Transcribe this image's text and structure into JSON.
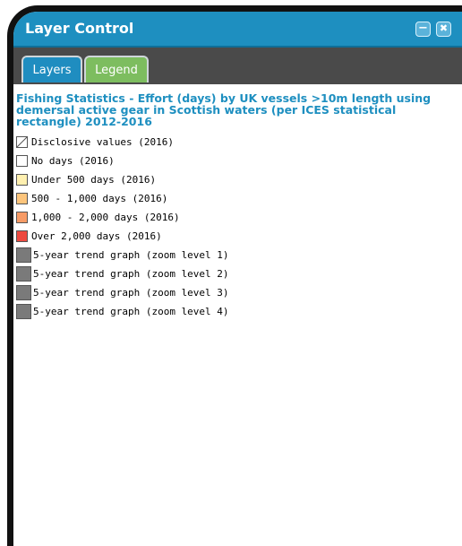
{
  "window": {
    "title": "Layer Control",
    "minimize_glyph": "−",
    "close_glyph": "✖"
  },
  "tabs": [
    {
      "label": "Layers",
      "color": "#1f8dc0"
    },
    {
      "label": "Legend",
      "color": "#7dbd5f",
      "active": true
    }
  ],
  "legend": {
    "title": "Fishing Statistics - Effort (days) by UK vessels >10m length using demersal active gear in Scottish waters (per ICES statistical rectangle) 2012-2016",
    "items": [
      {
        "label": "Disclosive values (2016)",
        "color": "#ffffff",
        "pattern": "diagonal"
      },
      {
        "label": "No days (2016)",
        "color": "#ffffff"
      },
      {
        "label": "Under 500 days (2016)",
        "color": "#fff0b0"
      },
      {
        "label": "500 - 1,000 days (2016)",
        "color": "#fdc57c"
      },
      {
        "label": "1,000 - 2,000 days (2016)",
        "color": "#f79b66"
      },
      {
        "label": "Over 2,000 days (2016)",
        "color": "#ee4a40"
      },
      {
        "label": "5-year trend graph (zoom level 1)",
        "color": "#7a7a7a"
      },
      {
        "label": "5-year trend graph (zoom level 2)",
        "color": "#7a7a7a"
      },
      {
        "label": "5-year trend graph (zoom level 3)",
        "color": "#7a7a7a"
      },
      {
        "label": "5-year trend graph (zoom level 4)",
        "color": "#7a7a7a"
      }
    ]
  }
}
